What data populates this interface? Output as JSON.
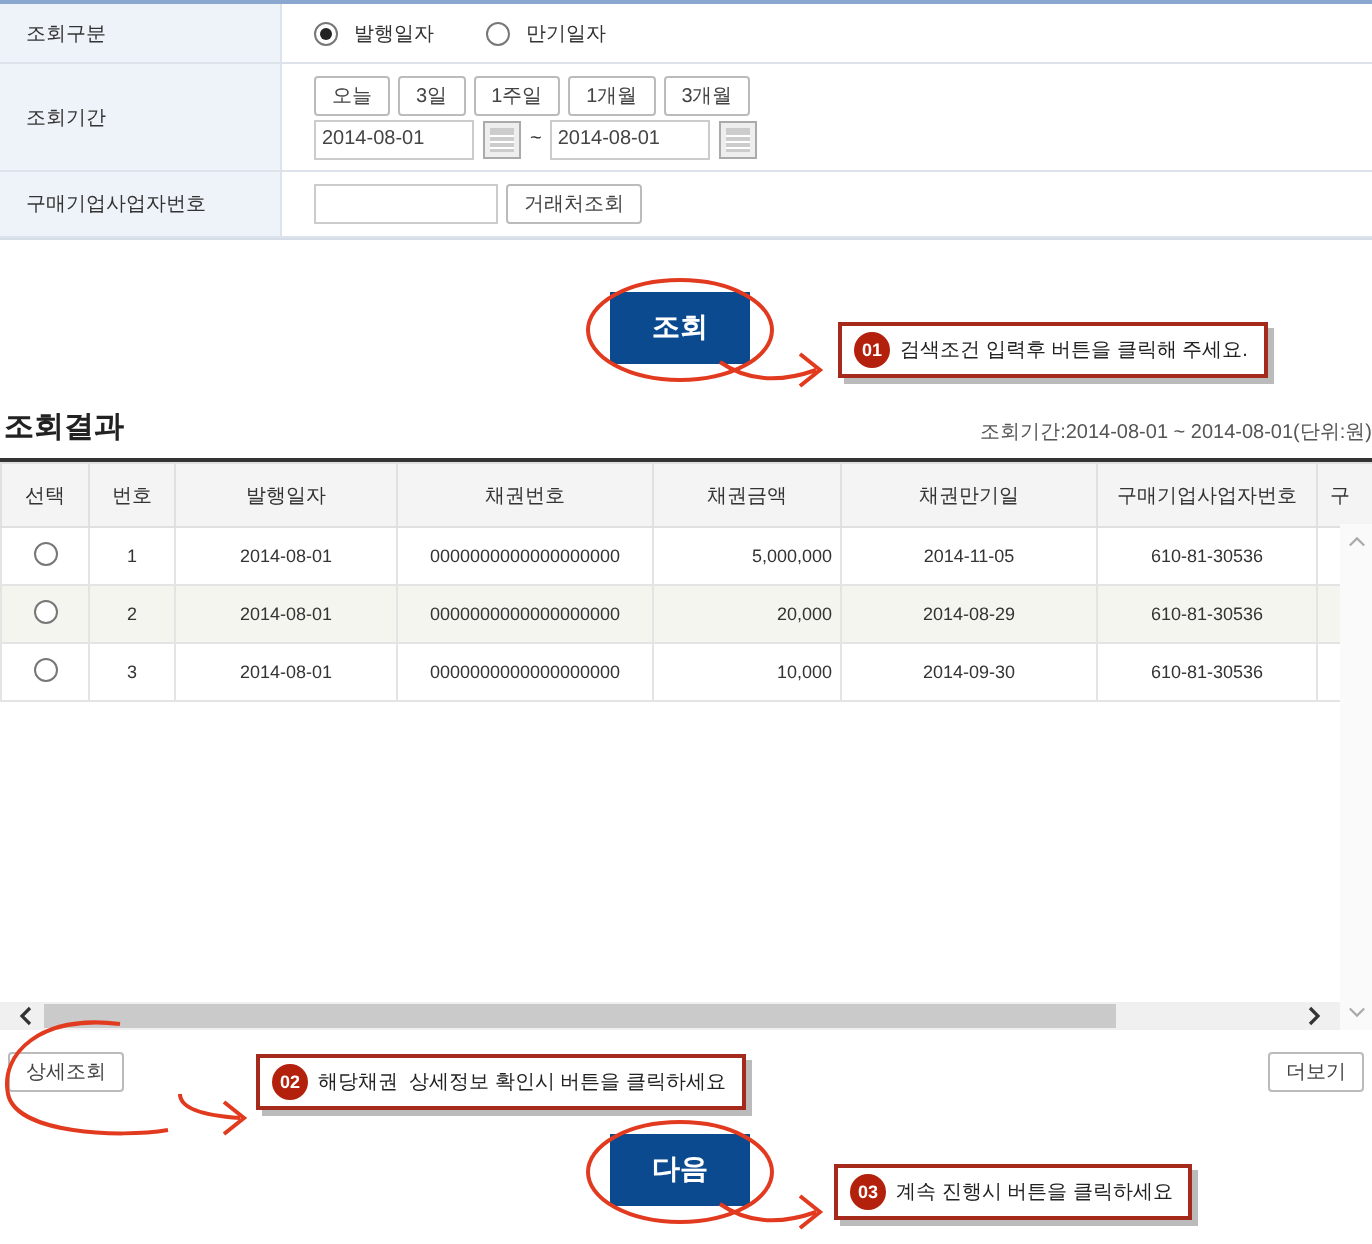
{
  "search_form": {
    "rows": [
      {
        "kind": "radio",
        "label": "조회구분",
        "options": [
          {
            "label": "발행일자",
            "selected": true
          },
          {
            "label": "만기일자",
            "selected": false
          }
        ]
      },
      {
        "kind": "period",
        "label": "조회기간",
        "quick_buttons": [
          "오늘",
          "3일",
          "1주일",
          "1개월",
          "3개월"
        ],
        "from": "2014-08-01",
        "separator": "~",
        "to": "2014-08-01"
      },
      {
        "kind": "lookup",
        "label": "구매기업사업자번호",
        "value_field": {},
        "button": "거래처조회"
      }
    ]
  },
  "search_button": "조회",
  "callouts": [
    {
      "number": "01",
      "text": "검색조건 입력후 버튼을 클릭해 주세요."
    },
    {
      "number": "02",
      "text": "해당채권  상세정보 확인시 버튼을 클릭하세요"
    },
    {
      "number": "03",
      "text": "계속 진행시 버튼을 클릭하세요"
    }
  ],
  "results": {
    "title": "조회결과",
    "period_note": "조회기간:2014-08-01 ~ 2014-08-01(단위:원)",
    "columns": [
      "선택",
      "번호",
      "발행일자",
      "채권번호",
      "채권금액",
      "채권만기일",
      "구매기업사업자번호",
      "구"
    ],
    "rows": [
      {
        "selected": false,
        "cells": [
          "",
          "1",
          "2014-08-01",
          "0000000000000000000",
          "5,000,000",
          "2014-11-05",
          "610-81-30536"
        ]
      },
      {
        "selected": false,
        "cells": [
          "",
          "2",
          "2014-08-01",
          "0000000000000000000",
          "20,000",
          "2014-08-29",
          "610-81-30536"
        ]
      },
      {
        "selected": false,
        "cells": [
          "",
          "3",
          "2014-08-01",
          "0000000000000000000",
          "10,000",
          "2014-09-30",
          "610-81-30536"
        ]
      }
    ]
  },
  "detail_button": "상세조회",
  "more_button": "더보기",
  "next_button": "다음"
}
